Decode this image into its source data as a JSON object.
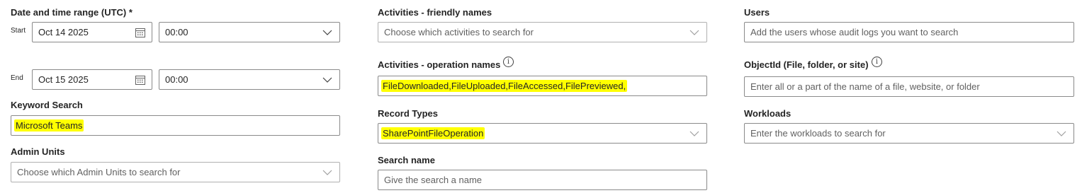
{
  "date_range": {
    "label": "Date and time range (UTC) *",
    "start_label": "Start",
    "start_date": "Oct 14 2025",
    "start_time": "00:00",
    "end_label": "End",
    "end_date": "Oct 15 2025",
    "end_time": "00:00"
  },
  "keyword": {
    "label": "Keyword Search",
    "value": "Microsoft Teams"
  },
  "admin_units": {
    "label": "Admin Units",
    "placeholder": "Choose which Admin Units to search for"
  },
  "activities_friendly": {
    "label": "Activities - friendly names",
    "placeholder": "Choose which activities to search for"
  },
  "activities_operation": {
    "label": "Activities - operation names",
    "value": "FileDownloaded,FileUploaded,FileAccessed,FilePreviewed,"
  },
  "record_types": {
    "label": "Record Types",
    "value": "SharePointFileOperation"
  },
  "search_name": {
    "label": "Search name",
    "placeholder": "Give the search a name"
  },
  "users": {
    "label": "Users",
    "placeholder": "Add the users whose audit logs you want to search"
  },
  "object_id": {
    "label": "ObjectId (File, folder, or site)",
    "placeholder": "Enter all or a part of the name of a file, website, or folder"
  },
  "workloads": {
    "label": "Workloads",
    "placeholder": "Enter the workloads to search for"
  },
  "icons": {
    "calendar": "calendar-icon",
    "chevron": "chevron-down-icon",
    "info": "info-icon"
  },
  "colors": {
    "highlight": "#ffff00",
    "border": "#8a8a8a",
    "placeholder": "#616161"
  }
}
